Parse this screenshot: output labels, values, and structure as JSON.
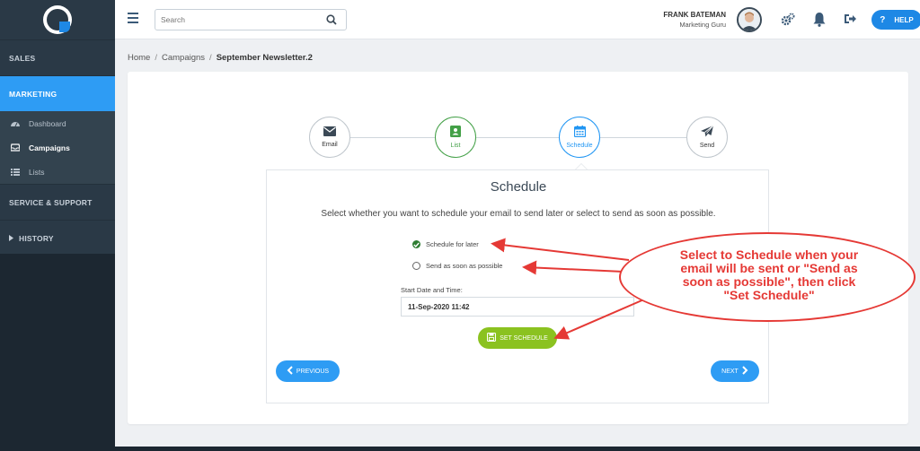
{
  "sidebar": {
    "sections": [
      {
        "label": "SALES"
      },
      {
        "label": "MARKETING"
      },
      {
        "label": "SERVICE & SUPPORT"
      },
      {
        "label": "HISTORY"
      }
    ],
    "items": [
      {
        "label": "Dashboard",
        "icon": "dashboard-icon"
      },
      {
        "label": "Campaigns",
        "icon": "inbox-icon"
      },
      {
        "label": "Lists",
        "icon": "list-icon"
      }
    ]
  },
  "topbar": {
    "search_placeholder": "Search",
    "user_name": "FRANK BATEMAN",
    "user_role": "Marketing Guru",
    "help_label": "HELP",
    "help_icon_glyph": "?"
  },
  "breadcrumb": {
    "items": [
      "Home",
      "Campaigns"
    ],
    "current": "September Newsletter.2"
  },
  "steps": [
    {
      "label": "Email",
      "state": "default"
    },
    {
      "label": "List",
      "state": "done"
    },
    {
      "label": "Schedule",
      "state": "active"
    },
    {
      "label": "Send",
      "state": "default"
    }
  ],
  "schedule": {
    "title": "Schedule",
    "description": "Select whether you want to schedule your email to send later or select to send as soon as possible.",
    "options": [
      {
        "label": "Schedule for later",
        "selected": true
      },
      {
        "label": "Send as soon as possible",
        "selected": false
      }
    ],
    "datetime_label": "Start Date and Time:",
    "datetime_value": "11-Sep-2020 11:42",
    "set_button": "SET SCHEDULE",
    "prev_button": "PREVIOUS",
    "next_button": "NEXT"
  },
  "annotation": {
    "lines": [
      "Select to Schedule when your",
      "email will be sent or \"Send as",
      "soon as possible\", then click",
      "\"Set Schedule\""
    ]
  },
  "colors": {
    "sidebar": "#2a3946",
    "active_blue": "#2e9cf4",
    "green": "#43a047",
    "set_button": "#8bc220",
    "annotation_red": "#e53935"
  }
}
